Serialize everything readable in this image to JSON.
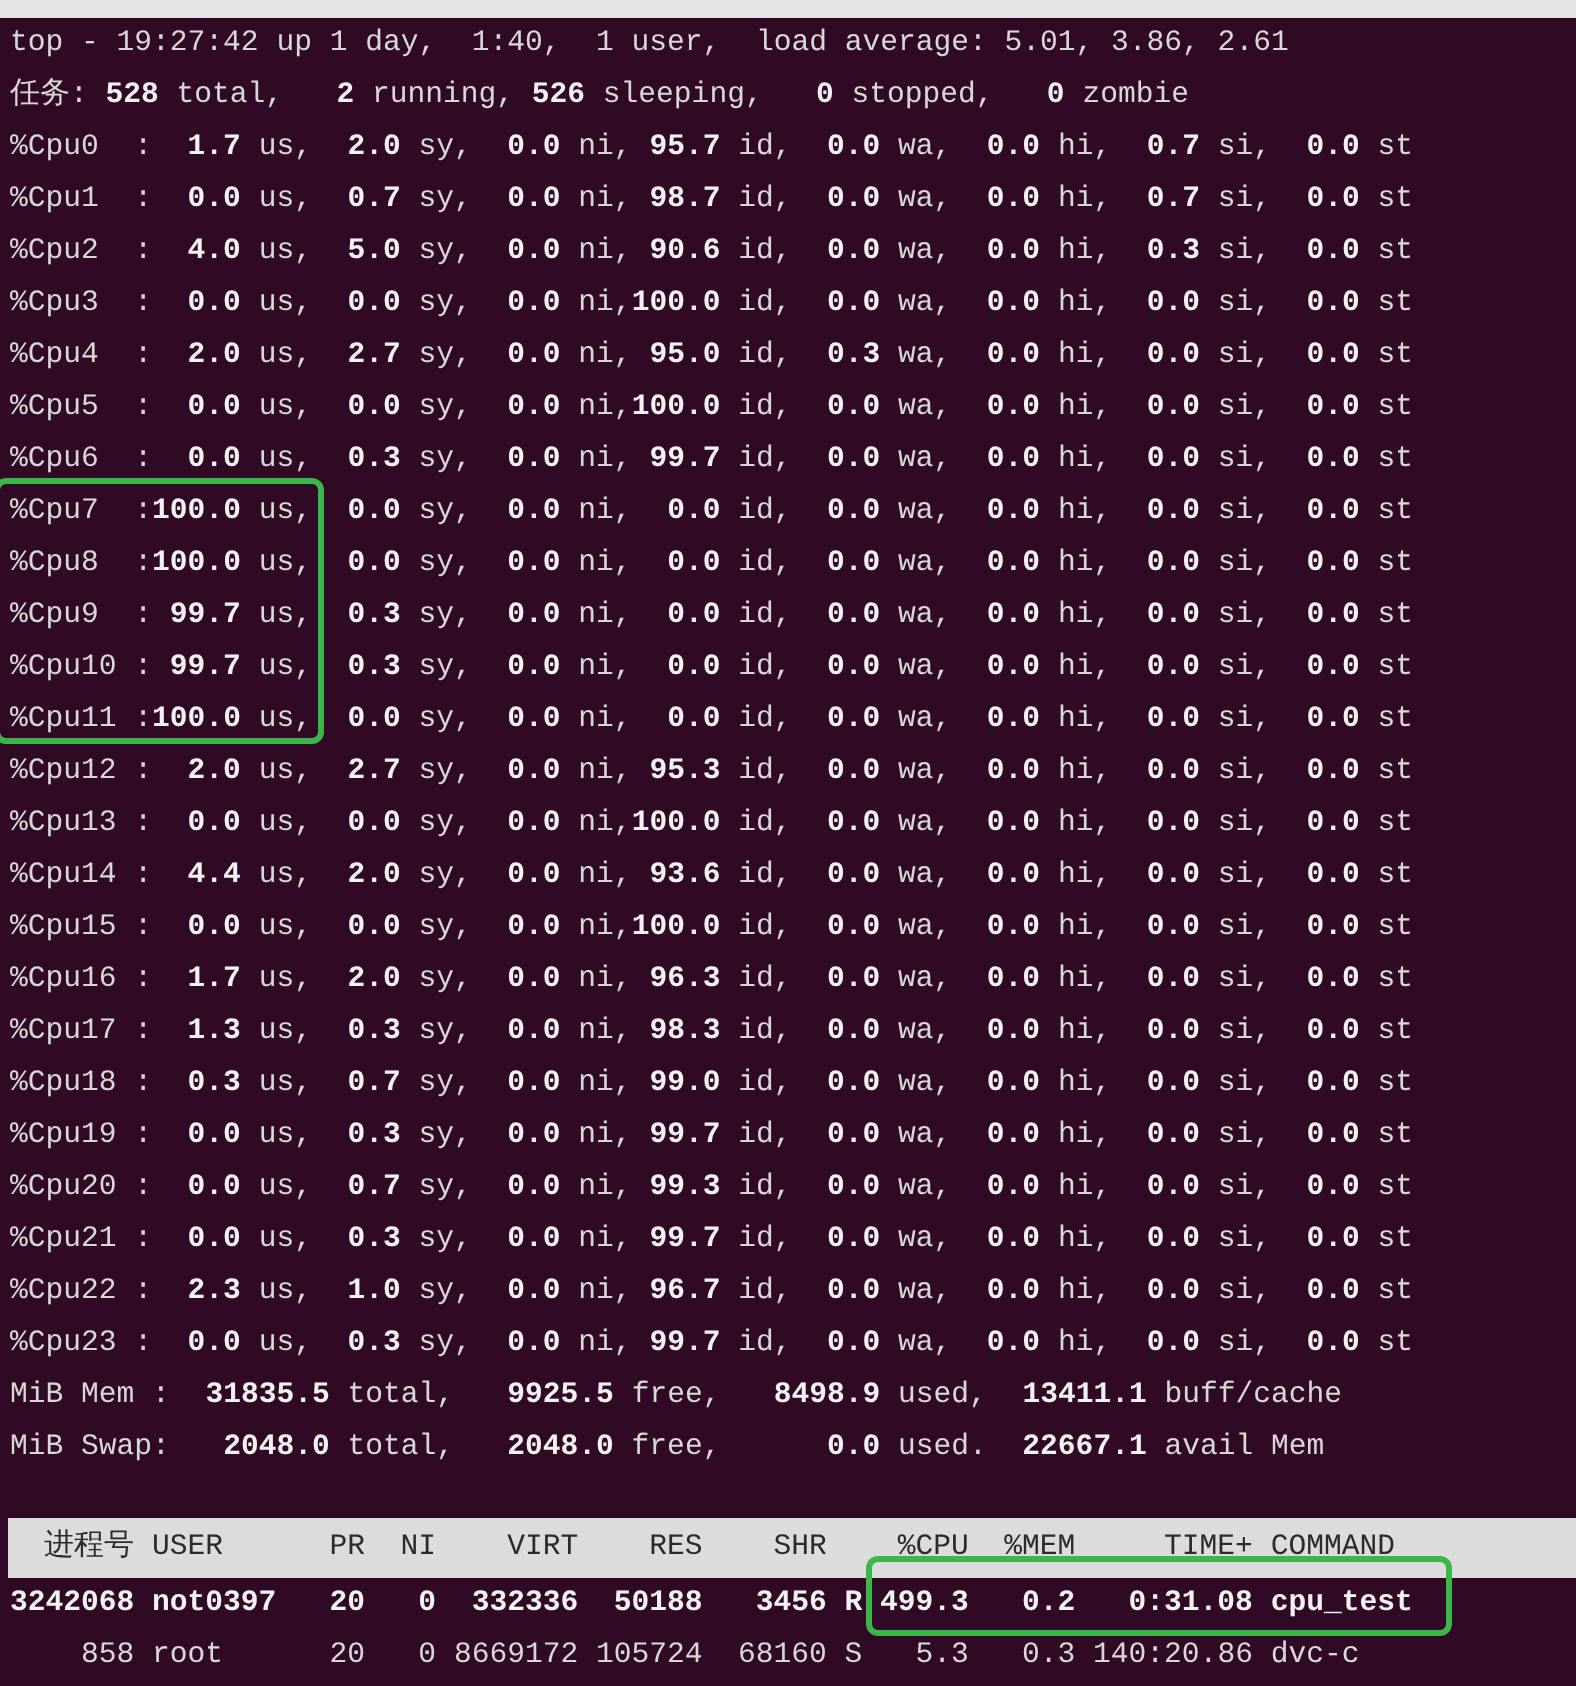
{
  "terminal": {
    "lines": [
      "top - 19:27:42 up 1 day,  1:40,  1 user,  load average: 5.01, 3.86, 2.61",
      "任务: **528** total,   **2** running, **526** sleeping,   **0** stopped,   **0** zombie",
      "%Cpu0  :  **1.7** us,  **2.0** sy,  **0.0** ni, **95.7** id,  **0.0** wa,  **0.0** hi,  **0.7** si,  **0.0** st",
      "%Cpu1  :  **0.0** us,  **0.7** sy,  **0.0** ni, **98.7** id,  **0.0** wa,  **0.0** hi,  **0.7** si,  **0.0** st",
      "%Cpu2  :  **4.0** us,  **5.0** sy,  **0.0** ni, **90.6** id,  **0.0** wa,  **0.0** hi,  **0.3** si,  **0.0** st",
      "%Cpu3  :  **0.0** us,  **0.0** sy,  **0.0** ni,**100.0** id,  **0.0** wa,  **0.0** hi,  **0.0** si,  **0.0** st",
      "%Cpu4  :  **2.0** us,  **2.7** sy,  **0.0** ni, **95.0** id,  **0.3** wa,  **0.0** hi,  **0.0** si,  **0.0** st",
      "%Cpu5  :  **0.0** us,  **0.0** sy,  **0.0** ni,**100.0** id,  **0.0** wa,  **0.0** hi,  **0.0** si,  **0.0** st",
      "%Cpu6  :  **0.0** us,  **0.3** sy,  **0.0** ni, **99.7** id,  **0.0** wa,  **0.0** hi,  **0.0** si,  **0.0** st",
      "%Cpu7  :**100.0** us,  **0.0** sy,  **0.0** ni,  **0.0** id,  **0.0** wa,  **0.0** hi,  **0.0** si,  **0.0** st",
      "%Cpu8  :**100.0** us,  **0.0** sy,  **0.0** ni,  **0.0** id,  **0.0** wa,  **0.0** hi,  **0.0** si,  **0.0** st",
      "%Cpu9  : **99.7** us,  **0.3** sy,  **0.0** ni,  **0.0** id,  **0.0** wa,  **0.0** hi,  **0.0** si,  **0.0** st",
      "%Cpu10 : **99.7** us,  **0.3** sy,  **0.0** ni,  **0.0** id,  **0.0** wa,  **0.0** hi,  **0.0** si,  **0.0** st",
      "%Cpu11 :**100.0** us,  **0.0** sy,  **0.0** ni,  **0.0** id,  **0.0** wa,  **0.0** hi,  **0.0** si,  **0.0** st",
      "%Cpu12 :  **2.0** us,  **2.7** sy,  **0.0** ni, **95.3** id,  **0.0** wa,  **0.0** hi,  **0.0** si,  **0.0** st",
      "%Cpu13 :  **0.0** us,  **0.0** sy,  **0.0** ni,**100.0** id,  **0.0** wa,  **0.0** hi,  **0.0** si,  **0.0** st",
      "%Cpu14 :  **4.4** us,  **2.0** sy,  **0.0** ni, **93.6** id,  **0.0** wa,  **0.0** hi,  **0.0** si,  **0.0** st",
      "%Cpu15 :  **0.0** us,  **0.0** sy,  **0.0** ni,**100.0** id,  **0.0** wa,  **0.0** hi,  **0.0** si,  **0.0** st",
      "%Cpu16 :  **1.7** us,  **2.0** sy,  **0.0** ni, **96.3** id,  **0.0** wa,  **0.0** hi,  **0.0** si,  **0.0** st",
      "%Cpu17 :  **1.3** us,  **0.3** sy,  **0.0** ni, **98.3** id,  **0.0** wa,  **0.0** hi,  **0.0** si,  **0.0** st",
      "%Cpu18 :  **0.3** us,  **0.7** sy,  **0.0** ni, **99.0** id,  **0.0** wa,  **0.0** hi,  **0.0** si,  **0.0** st",
      "%Cpu19 :  **0.0** us,  **0.3** sy,  **0.0** ni, **99.7** id,  **0.0** wa,  **0.0** hi,  **0.0** si,  **0.0** st",
      "%Cpu20 :  **0.0** us,  **0.7** sy,  **0.0** ni, **99.3** id,  **0.0** wa,  **0.0** hi,  **0.0** si,  **0.0** st",
      "%Cpu21 :  **0.0** us,  **0.3** sy,  **0.0** ni, **99.7** id,  **0.0** wa,  **0.0** hi,  **0.0** si,  **0.0** st",
      "%Cpu22 :  **2.3** us,  **1.0** sy,  **0.0** ni, **96.7** id,  **0.0** wa,  **0.0** hi,  **0.0** si,  **0.0** st",
      "%Cpu23 :  **0.0** us,  **0.3** sy,  **0.0** ni, **99.7** id,  **0.0** wa,  **0.0** hi,  **0.0** si,  **0.0** st",
      "MiB Mem :  **31835.5** total,   **9925.5** free,   **8498.9** used,  **13411.1** buff/cache",
      "MiB Swap:   **2048.0** total,   **2048.0** free,      **0.0** used.  **22667.1** avail Mem"
    ],
    "processes": {
      "columns": [
        "进程号",
        "USER",
        "PR",
        "NI",
        "VIRT",
        "RES",
        "SHR",
        "",
        "%CPU",
        "%MEM",
        "TIME+",
        "COMMAND"
      ],
      "rows": [
        {
          "running": true,
          "cells": [
            "3242068",
            "not0397",
            "20",
            "0",
            "332336",
            "50188",
            "3456",
            "R",
            "499.3",
            "0.2",
            "0:31.08",
            "cpu_test"
          ]
        },
        {
          "running": false,
          "cells": [
            "858",
            "root",
            "20",
            "0",
            "8669172",
            "105724",
            "68160",
            "S",
            "5.3",
            "0.3",
            "140:20.86",
            "dvc-c"
          ]
        }
      ]
    },
    "annotations": [
      {
        "kind": "box",
        "color": "#3cb54a"
      },
      {
        "kind": "box",
        "color": "#3cb54a"
      }
    ]
  }
}
